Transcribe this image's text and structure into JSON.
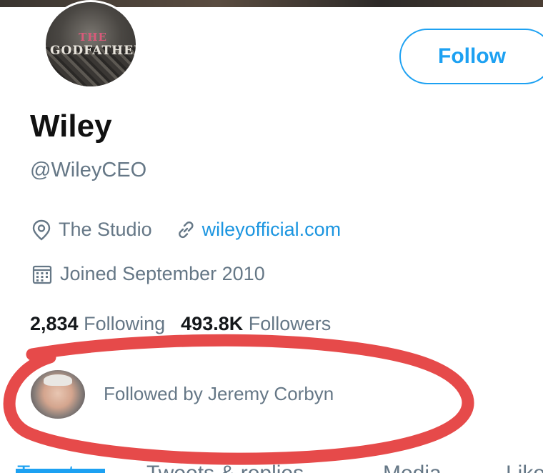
{
  "profile": {
    "avatar_text_line1": "THE",
    "avatar_text_line2": "GODFATHER",
    "name": "Wiley",
    "handle": "@WileyCEO",
    "location": "The Studio",
    "website": "wileyofficial.com",
    "joined": "Joined September 2010"
  },
  "actions": {
    "follow_label": "Follow"
  },
  "stats": {
    "following_count": "2,834",
    "following_label": "Following",
    "followers_count": "493.8K",
    "followers_label": "Followers"
  },
  "followed_by": {
    "text": "Followed by Jeremy Corbyn"
  },
  "tabs": [
    "Tweets",
    "Tweets & replies",
    "Media",
    "Likes"
  ],
  "colors": {
    "accent": "#1da1f2",
    "link": "#1b95e0",
    "annotation": "#e64a4a",
    "muted": "#657786"
  },
  "icons": [
    "location-pin-icon",
    "link-icon",
    "calendar-icon"
  ]
}
